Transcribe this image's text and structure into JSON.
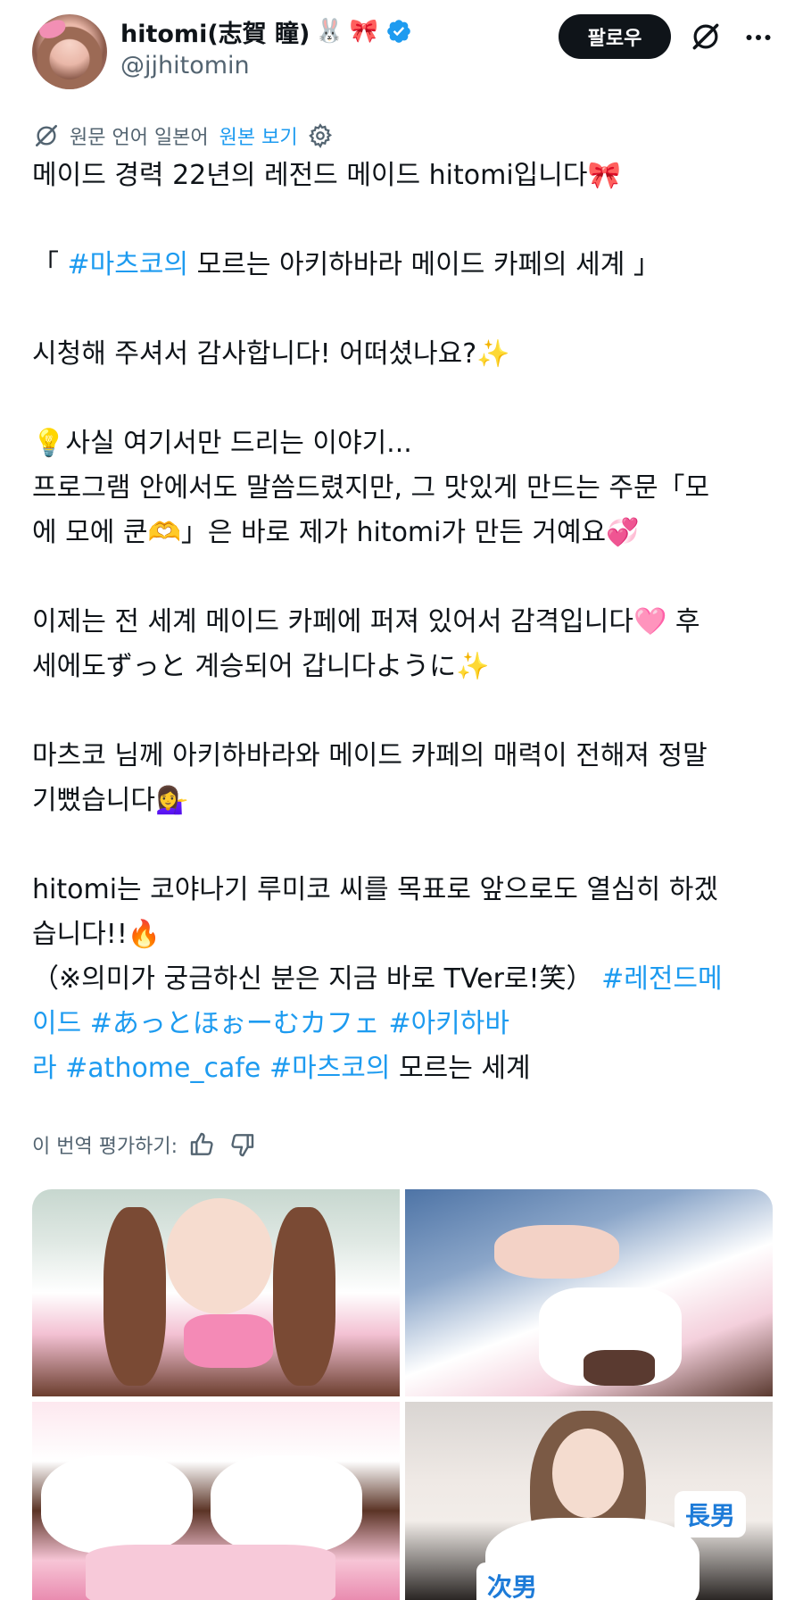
{
  "user": {
    "display_name": "hitomi(志賀 瞳)",
    "display_name_emojis": [
      "🐰",
      "🎀"
    ],
    "handle": "@jjhitomin",
    "verified": true
  },
  "actions": {
    "follow_label": "팔로우"
  },
  "translation": {
    "source_language_text": "원문 언어 일본어",
    "view_original_label": "원본 보기",
    "rate_translation_label": "이 번역 평가하기:"
  },
  "post": {
    "lines": [
      [
        {
          "t": "메이드 경력 22년의 레전드 메이드 hitomi입니다"
        },
        {
          "t": "🎀",
          "emo": true
        }
      ],
      [],
      [
        {
          "t": "「 "
        },
        {
          "t": "#마츠코의",
          "tag": true
        },
        {
          "t": " 모르는 아키하바라 메이드 카페의 세계 」"
        }
      ],
      [],
      [
        {
          "t": "시청해 주셔서 감사합니다! 어떠셨나요?"
        },
        {
          "t": "✨",
          "emo": true
        }
      ],
      [],
      [
        {
          "t": "💡",
          "emo": true
        },
        {
          "t": "사실 여기서만 드리는 이야기..."
        }
      ],
      [
        {
          "t": "프로그램 안에서도 말씀드렸지만, 그 맛있게 만드는 주문「모"
        }
      ],
      [
        {
          "t": "에 모에 쿤"
        },
        {
          "t": "🫶",
          "emo": true
        },
        {
          "t": "」은 바로 제가 hitomi가 만든 거예요"
        },
        {
          "t": "💞",
          "emo": true
        }
      ],
      [],
      [
        {
          "t": "이제는 전 세계 메이드 카페에 퍼져 있어서 감격입니다"
        },
        {
          "t": "🩷",
          "emo": true
        },
        {
          "t": " 후"
        }
      ],
      [
        {
          "t": "세에도ずっと 계승되어 갑니다ように"
        },
        {
          "t": "✨",
          "emo": true
        }
      ],
      [],
      [
        {
          "t": "마츠코 님께 아키하바라와 메이드 카페의 매력이 전해져 정말"
        }
      ],
      [
        {
          "t": "기뻤습니다"
        },
        {
          "t": "💁‍♀️",
          "emo": true
        }
      ],
      [],
      [
        {
          "t": "hitomi는 코야나기 루미코 씨를 목표로 앞으로도 열심히 하겠"
        }
      ],
      [
        {
          "t": "습니다!!"
        },
        {
          "t": "🔥",
          "emo": true
        }
      ],
      [
        {
          "t": "（※의미가 궁금하신 분은 지금 바로 TVer로!笑） "
        },
        {
          "t": "#레전드메",
          "tag": true
        }
      ],
      [
        {
          "t": "이드",
          "tag": true
        },
        {
          "t": "   "
        },
        {
          "t": "#あっとほぉーむカフェ",
          "tag": true
        },
        {
          "t": " "
        },
        {
          "t": "#아키하바",
          "tag": true
        }
      ],
      [
        {
          "t": "라",
          "tag": true
        },
        {
          "t": "   "
        },
        {
          "t": "#athome_cafe",
          "tag": true
        },
        {
          "t": " "
        },
        {
          "t": "#마츠코의",
          "tag": true
        },
        {
          "t": " 모르는 세계"
        }
      ]
    ]
  },
  "media": {
    "badges": [
      "長男",
      "次男"
    ]
  },
  "colors": {
    "link": "#1d9bf0",
    "text": "#0f1419",
    "secondary": "#536471",
    "verified": "#1d9bf0"
  },
  "icons": [
    "verified-badge-icon",
    "grok-icon",
    "more-icon",
    "translate-icon",
    "settings-gear-icon",
    "thumbs-up-icon",
    "thumbs-down-icon"
  ]
}
